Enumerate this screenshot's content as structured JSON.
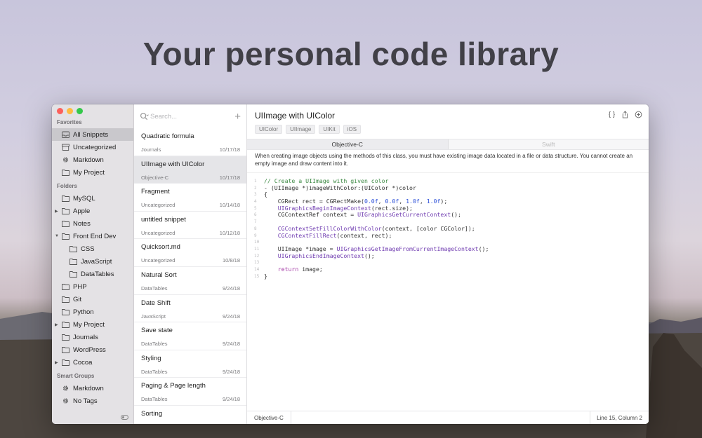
{
  "headline": "Your personal code library",
  "sidebar": {
    "favorites_header": "Favorites",
    "favorites": [
      {
        "label": "All Snippets",
        "icon": "tray-icon",
        "active": true
      },
      {
        "label": "Uncategorized",
        "icon": "box-icon"
      },
      {
        "label": "Markdown",
        "icon": "gear-icon"
      },
      {
        "label": "My Project",
        "icon": "folder-icon"
      }
    ],
    "folders_header": "Folders",
    "folders": [
      {
        "label": "MySQL",
        "icon": "folder-icon"
      },
      {
        "label": "Apple",
        "icon": "folder-icon",
        "arrow": "right"
      },
      {
        "label": "Notes",
        "icon": "folder-icon"
      },
      {
        "label": "Front End Dev",
        "icon": "folder-icon",
        "arrow": "down"
      },
      {
        "label": "CSS",
        "icon": "folder-icon",
        "indent": true
      },
      {
        "label": "JavaScript",
        "icon": "folder-icon",
        "indent": true
      },
      {
        "label": "DataTables",
        "icon": "folder-icon",
        "indent": true
      },
      {
        "label": "PHP",
        "icon": "folder-icon"
      },
      {
        "label": "Git",
        "icon": "folder-icon"
      },
      {
        "label": "Python",
        "icon": "folder-icon"
      },
      {
        "label": "My Project",
        "icon": "folder-icon",
        "arrow": "right"
      },
      {
        "label": "Journals",
        "icon": "folder-icon"
      },
      {
        "label": "WordPress",
        "icon": "folder-icon"
      },
      {
        "label": "Cocoa",
        "icon": "folder-icon",
        "arrow": "right"
      }
    ],
    "smart_header": "Smart Groups",
    "smart": [
      {
        "label": "Markdown",
        "icon": "gear-icon"
      },
      {
        "label": "No Tags",
        "icon": "gear-icon"
      }
    ]
  },
  "list": {
    "search_placeholder": "Search...",
    "snippets": [
      {
        "title": "Quadratic formula",
        "category": "Journals",
        "date": "10/17/18"
      },
      {
        "title": "UIImage with UIColor",
        "category": "Objective-C",
        "date": "10/17/18",
        "active": true
      },
      {
        "title": "Fragment",
        "category": "Uncategorized",
        "date": "10/14/18"
      },
      {
        "title": "untitled snippet",
        "category": "Uncategorized",
        "date": "10/12/18"
      },
      {
        "title": "Quicksort.md",
        "category": "Uncategorized",
        "date": "10/8/18"
      },
      {
        "title": "Natural Sort",
        "category": "DataTables",
        "date": "9/24/18"
      },
      {
        "title": "Date Shift",
        "category": "JavaScript",
        "date": "9/24/18"
      },
      {
        "title": "Save state",
        "category": "DataTables",
        "date": "9/24/18"
      },
      {
        "title": "Styling",
        "category": "DataTables",
        "date": "9/24/18"
      },
      {
        "title": "Paging & Page length",
        "category": "DataTables",
        "date": "9/24/18"
      },
      {
        "title": "Sorting",
        "category": "DataTables",
        "date": "9/24/18"
      }
    ]
  },
  "editor": {
    "title": "UIImage with UIColor",
    "tags": [
      "UIColor",
      "UIImage",
      "UIKit",
      "iOS"
    ],
    "tabs": [
      "Objective-C",
      "Swift"
    ],
    "description": "When creating image objects using the methods of this class, you must have existing image data located in a file or data structure. You cannot create an empty image and draw content into it.",
    "code": [
      [
        [
          "c-com",
          "// Create a UIImage with given color"
        ]
      ],
      [
        [
          "",
          "- (UIImage *)imageWithColor:(UIColor *)color"
        ]
      ],
      [
        [
          "",
          "{"
        ]
      ],
      [
        [
          "",
          "    CGRect rect = CGRectMake("
        ],
        [
          "c-num",
          "0.0f"
        ],
        [
          "",
          ", "
        ],
        [
          "c-num",
          "0.0f"
        ],
        [
          "",
          ", "
        ],
        [
          "c-num",
          "1.0f"
        ],
        [
          "",
          ", "
        ],
        [
          "c-num",
          "1.0f"
        ],
        [
          "",
          ");"
        ]
      ],
      [
        [
          "c-fn",
          "    UIGraphicsBeginImageContext"
        ],
        [
          "",
          "(rect.size);"
        ]
      ],
      [
        [
          "",
          "    CGContextRef context = "
        ],
        [
          "c-fn",
          "UIGraphicsGetCurrentContext"
        ],
        [
          "",
          "();"
        ]
      ],
      [
        [
          "",
          ""
        ]
      ],
      [
        [
          "c-fn",
          "    CGContextSetFillColorWithColor"
        ],
        [
          "",
          "(context, [color CGColor]);"
        ]
      ],
      [
        [
          "c-fn",
          "    CGContextFillRect"
        ],
        [
          "",
          "(context, rect);"
        ]
      ],
      [
        [
          "",
          ""
        ]
      ],
      [
        [
          "",
          "    UIImage *image = "
        ],
        [
          "c-fn",
          "UIGraphicsGetImageFromCurrentImageContext"
        ],
        [
          "",
          "();"
        ]
      ],
      [
        [
          "c-fn",
          "    UIGraphicsEndImageContext"
        ],
        [
          "",
          "();"
        ]
      ],
      [
        [
          "",
          ""
        ]
      ],
      [
        [
          "c-kw",
          "    return"
        ],
        [
          "",
          " image;"
        ]
      ],
      [
        [
          "",
          "}"
        ]
      ]
    ],
    "status_language": "Objective-C",
    "status_position": "Line 15, Column 2"
  }
}
